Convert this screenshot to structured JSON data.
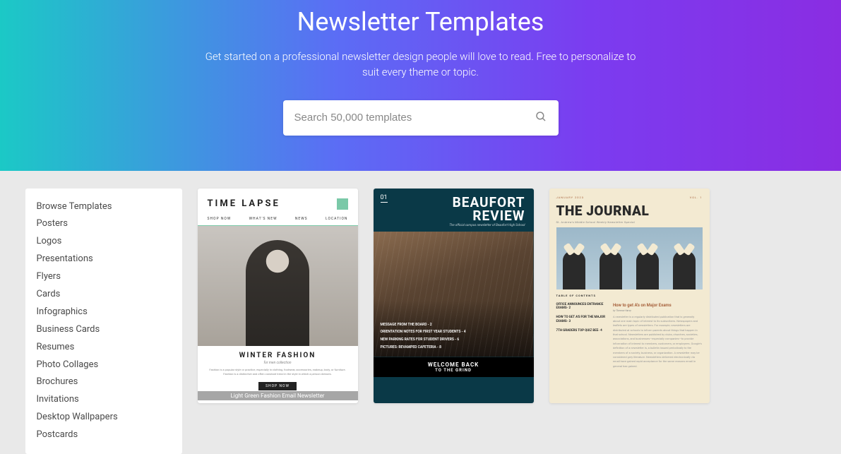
{
  "hero": {
    "title": "Newsletter Templates",
    "subtitle": "Get started on a professional newsletter design people will love to read. Free to personalize to suit every theme or topic."
  },
  "search": {
    "placeholder": "Search 50,000 templates"
  },
  "sidebar": {
    "items": [
      "Browse Templates",
      "Posters",
      "Logos",
      "Presentations",
      "Flyers",
      "Cards",
      "Infographics",
      "Business Cards",
      "Resumes",
      "Photo Collages",
      "Brochures",
      "Invitations",
      "Desktop Wallpapers",
      "Postcards"
    ]
  },
  "templates": [
    {
      "brand": "TIME LAPSE",
      "nav": [
        "SHOP NOW",
        "WHAT'S NEW",
        "NEWS",
        "LOCATION"
      ],
      "headline": "WINTER FASHION",
      "sub": "for men collection",
      "desc": "Fashion is a popular style or practice, especially in clothing, footwear, accessories, makeup, body, or furniture. Fashion is a distinctive and often constant trend in the style in which a person dresses.",
      "cta": "SHOP NOW",
      "caption": "Light Green Fashion Email Newsletter"
    },
    {
      "issue": "01",
      "title1": "BEAUFORT",
      "title2": "REVIEW",
      "sub": "The official campus newsletter of Beaufort High School",
      "lines": [
        "MESSAGE FROM THE BOARD - 2",
        "ORIENTATION NOTES FOR FIRST YEAR STUDENTS - 4",
        "NEW PARKING RATES FOR STUDENT DRIVERS - 6",
        "PICTURES: REVAMPED CAFETERIA - 8"
      ],
      "foot1": "WELCOME BACK",
      "foot2": "TO THE GRIND"
    },
    {
      "date": "JANUARY 2023",
      "vol": "VOL. 1",
      "title": "THE JOURNAL",
      "sub": "St. Andrew's Middle School Weekly Newsletter Special",
      "toc": "TABLE OF CONTENTS",
      "leftItems": [
        "OFFICE ANNOUNCES ENTRANCE EXAMS- 2",
        "HOW TO GET A'S FOR THE MAJOR EXAMS- 3",
        "7TH GRADERS TOP QUIZ BEE- 4"
      ],
      "articleTitle": "How to get A's on Major Exams",
      "byline": "by Therese Harvy",
      "body": "A newsletter is a regularly distributed publication that is generally about one main topic of interest to its subscribers. Newspapers and leaflets are types of newsletters. For example, newsletters are distributed at schools to inform parents about things that happen in that school. Newsletters are published by clubs, churches, societies, associations, and businesses—especially companies—to provide information of interest to members, customers, or employees. Google's definition of a newsletter is, a bulletin issued periodically to the members of a society, business, or organization. A newsletter may be considered grey literature. Newsletters delivered electronically via email have gained rapid acceptance for the same reasons email in general has gained."
    }
  ]
}
